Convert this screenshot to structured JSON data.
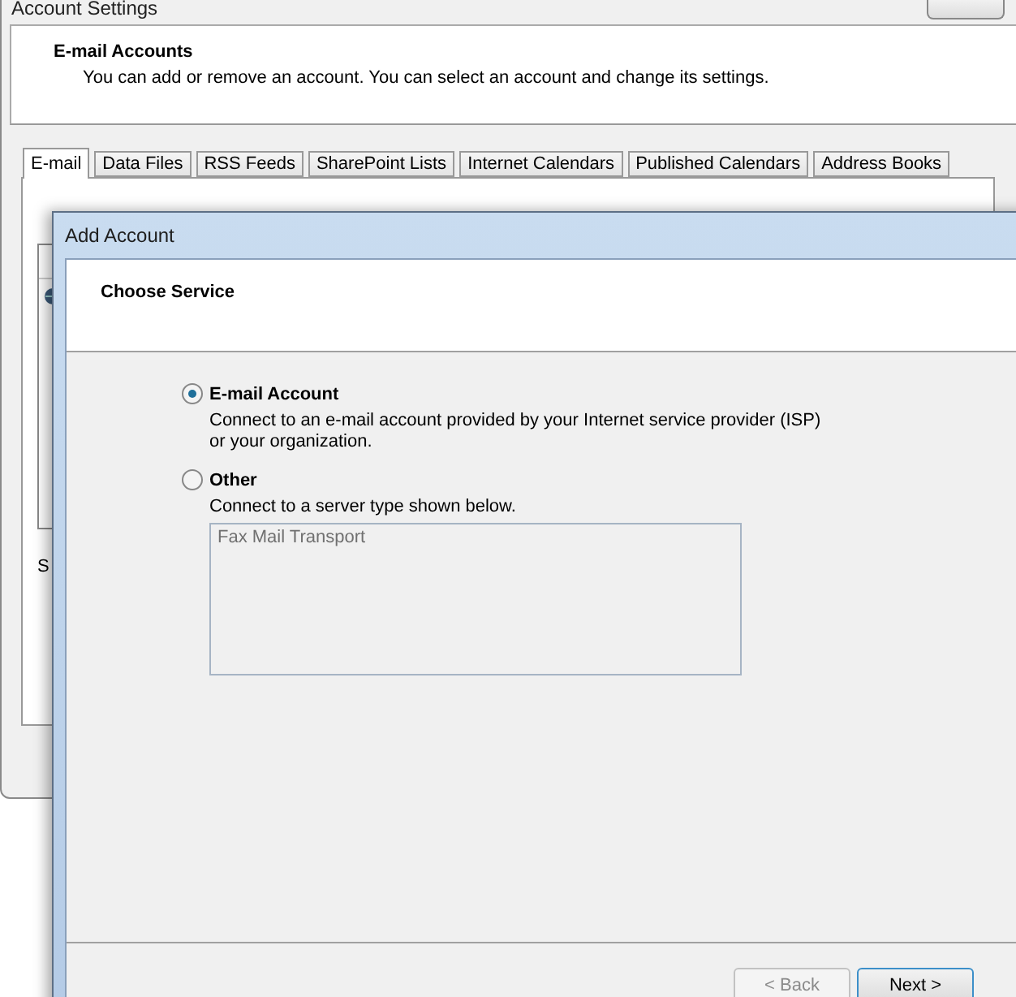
{
  "background_window": {
    "title": "Account Settings",
    "header": {
      "title": "E-mail Accounts",
      "description": "You can add or remove an account. You can select an account and change its settings."
    },
    "tabs": [
      {
        "label": "E-mail",
        "selected": true
      },
      {
        "label": "Data Files",
        "selected": false
      },
      {
        "label": "RSS Feeds",
        "selected": false
      },
      {
        "label": "SharePoint Lists",
        "selected": false
      },
      {
        "label": "Internet Calendars",
        "selected": false
      },
      {
        "label": "Published Calendars",
        "selected": false
      },
      {
        "label": "Address Books",
        "selected": false
      }
    ],
    "label_fragment": "S"
  },
  "dialog": {
    "title": "Add Account",
    "heading": "Choose Service",
    "options": [
      {
        "label": "E-mail Account",
        "description": "Connect to an e-mail account provided by your Internet service provider (ISP) or your organization.",
        "selected": true
      },
      {
        "label": "Other",
        "description": "Connect to a server type shown below.",
        "selected": false
      }
    ],
    "server_types": [
      "Fax Mail Transport"
    ],
    "buttons": [
      {
        "label": "< Back",
        "disabled": true
      },
      {
        "label": "Next >",
        "disabled": false
      }
    ]
  }
}
